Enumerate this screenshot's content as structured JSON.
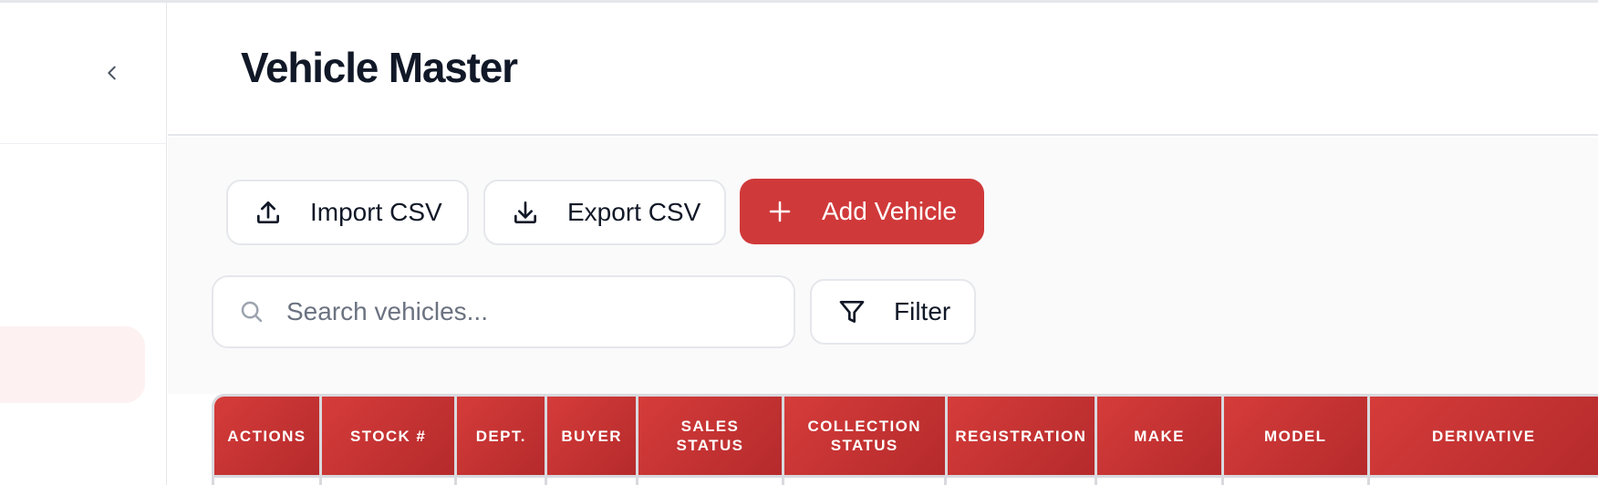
{
  "page": {
    "title": "Vehicle Master"
  },
  "toolbar": {
    "import_label": "Import CSV",
    "export_label": "Export CSV",
    "add_label": "Add Vehicle",
    "filter_label": "Filter"
  },
  "search": {
    "placeholder": "Search vehicles...",
    "value": ""
  },
  "table": {
    "columns": [
      "ACTIONS",
      "STOCK #",
      "DEPT.",
      "BUYER",
      "SALES STATUS",
      "COLLECTION STATUS",
      "REGISTRATION",
      "MAKE",
      "MODEL",
      "DERIVATIVE"
    ]
  },
  "icons": {
    "collapse": "chevron-left-icon",
    "import": "upload-icon",
    "export": "download-icon",
    "add": "plus-icon",
    "search": "search-icon",
    "filter": "funnel-icon"
  },
  "colors": {
    "accent": "#d0393a",
    "header_gradient_start": "#d53c3a",
    "header_gradient_end": "#b52a2c",
    "sidebar_active_bg": "#fdf1f1",
    "border": "#e5e7eb"
  }
}
